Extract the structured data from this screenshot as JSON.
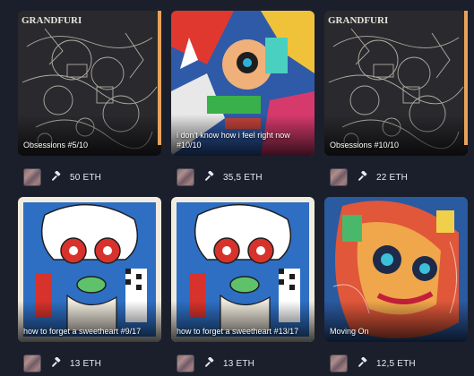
{
  "cards": [
    {
      "title": "Obsessions #5/10",
      "price": "50 ETH",
      "logo_text": "GRANDFURI"
    },
    {
      "title": "i don't know how i feel right now #10/10",
      "price": "35,5 ETH"
    },
    {
      "title": "Obsessions #10/10",
      "price": "22 ETH",
      "logo_text": "GRANDFURI"
    },
    {
      "title": "how to forget a sweetheart #9/17",
      "price": "13 ETH"
    },
    {
      "title": "how to forget a sweetheart #13/17",
      "price": "13 ETH"
    },
    {
      "title": "Moving On",
      "price": "12,5 ETH"
    }
  ],
  "colors": {
    "background": "#1b1f2b",
    "accent_edge": "#e8a35a"
  },
  "icons": {
    "bid": "gavel-icon",
    "owner": "avatar-thumbnail"
  }
}
